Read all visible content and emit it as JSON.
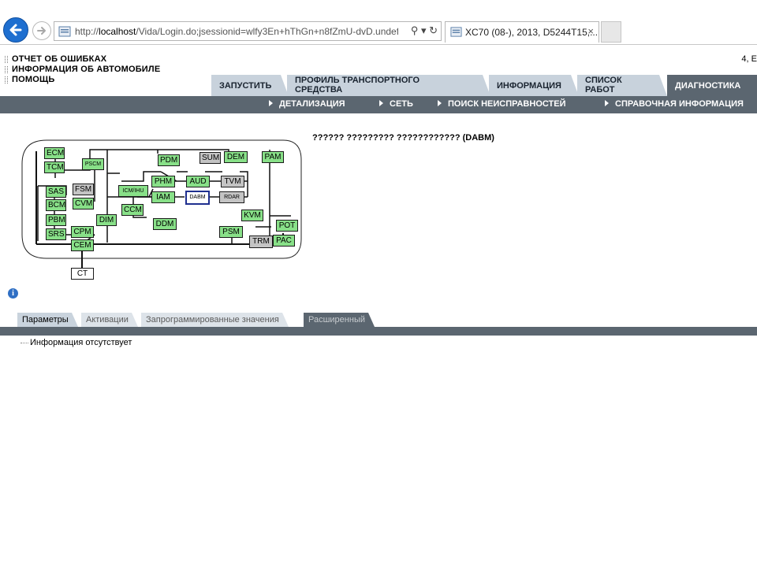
{
  "browser": {
    "url_prefix": "http://",
    "url_host": "localhost",
    "url_path": "/Vida/Login.do;jsessionid=wlfy3En+hThGn+n8fZmU-dvD.undef",
    "address_tools": "⚲ ▾ ↻",
    "tab_title": "XC70 (08-), 2013, D5244T15,...",
    "tab_close": "×"
  },
  "header": {
    "left_links": [
      "ОТЧЕТ ОБ ОШИБКАХ",
      "ИНФОРМАЦИЯ ОБ АВТОМОБИЛЕ",
      "ПОМОЩЬ"
    ],
    "top_right": "4, E"
  },
  "main_tabs": [
    {
      "label": "ЗАПУСТИТЬ",
      "active": false
    },
    {
      "label": "ПРОФИЛЬ ТРАНСПОРТНОГО",
      "label2": "СРЕДСТВА",
      "active": false
    },
    {
      "label": "ИНФОРМАЦИЯ",
      "active": false
    },
    {
      "label": "СПИСОК",
      "label2": "РАБОТ",
      "active": false
    },
    {
      "label": "ДИАГНОСТИКА",
      "active": true
    }
  ],
  "sub_nav": [
    "ДЕТАЛИЗАЦИЯ",
    "СЕТЬ",
    "ПОИСК НЕИСПРАВНОСТЕЙ",
    "СПРАВОЧНАЯ ИНФОРМАЦИЯ"
  ],
  "ecu_title": "?????? ????????? ???????????? (DABM)",
  "network_modules": {
    "ECM": "ECM",
    "TCM": "TCM",
    "PSCM": "PSCM",
    "PDM": "PDM",
    "SUM": "SUM",
    "DEM": "DEM",
    "PAM": "PAM",
    "SAS": "SAS",
    "FSM": "FSM",
    "ICM": "ICM/IHU",
    "PHM": "PHM",
    "AUD": "AUD",
    "TVM": "TVM",
    "BCM": "BCM",
    "CVM": "CVM",
    "IAM": "IAM",
    "DABM": "DABM",
    "RDAR": "RDAR",
    "CCM": "CCM",
    "KVM": "KVM",
    "PBM": "PBM",
    "DIM": "DIM",
    "DDM": "DDM",
    "POT": "POT",
    "SRS": "SRS",
    "CPM": "CPM",
    "PSM": "PSM",
    "CEM": "CEM",
    "TRM": "TRM",
    "PAC": "PAC",
    "CT": "CT"
  },
  "info_icon_glyph": "i",
  "sub_tabs": [
    {
      "label": "Параметры",
      "active": false
    },
    {
      "label": "Активации",
      "active": false
    },
    {
      "label": "Запрограммированные значения",
      "active": false
    },
    {
      "label": "Расширенный",
      "active": true
    }
  ],
  "result_text": "Информация отсутствует",
  "colors": {
    "module_ok": "#88e088",
    "module_no_response": "#c4c4c4",
    "nav_dark": "#5b6670",
    "tab_light": "#c8d2dc",
    "selected_border": "#1f2f8f"
  }
}
